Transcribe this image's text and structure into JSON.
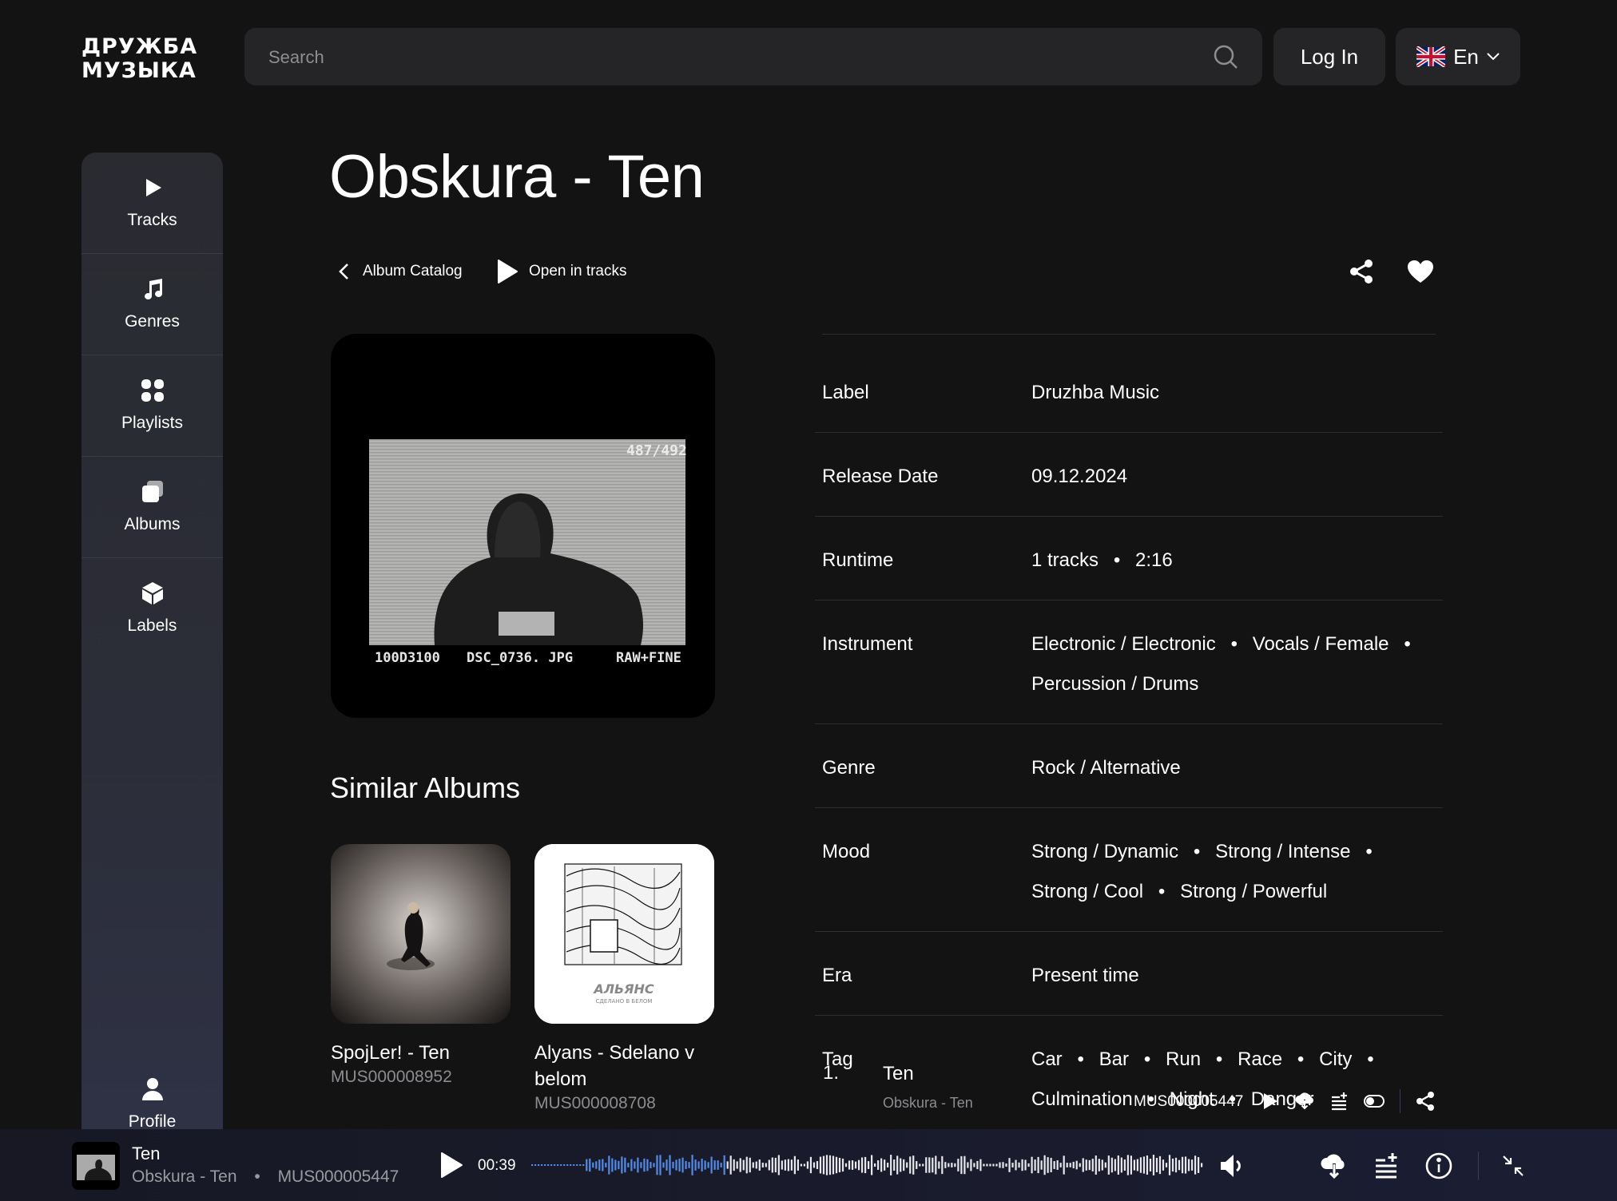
{
  "header": {
    "logo_line1": "ДРУЖБА",
    "logo_line2": "МУЗЫКА",
    "search_placeholder": "Search",
    "login_label": "Log In",
    "language": "En"
  },
  "sidebar": {
    "items": [
      {
        "label": "Tracks",
        "icon": "play-icon"
      },
      {
        "label": "Genres",
        "icon": "music-note-icon"
      },
      {
        "label": "Playlists",
        "icon": "grid-icon"
      },
      {
        "label": "Albums",
        "icon": "albums-icon"
      },
      {
        "label": "Labels",
        "icon": "cube-icon"
      }
    ],
    "profile_label": "Profile"
  },
  "album": {
    "title": "Obskura - Ten",
    "back_label": "Album Catalog",
    "open_tracks_label": "Open in tracks",
    "cover_counter": "487/492",
    "cover_footer_left": "100D3100",
    "cover_footer_mid": "DSC_0736. JPG",
    "cover_footer_right": "RAW+FINE"
  },
  "info": {
    "label": {
      "key": "Label",
      "value": "Druzhba Music"
    },
    "release": {
      "key": "Release Date",
      "value": "09.12.2024"
    },
    "runtime": {
      "key": "Runtime",
      "tracks": "1 tracks",
      "duration": "2:16"
    },
    "instrument": {
      "key": "Instrument",
      "values": [
        "Electronic / Electronic",
        "Vocals / Female",
        "Percussion / Drums"
      ]
    },
    "genre": {
      "key": "Genre",
      "value": "Rock / Alternative"
    },
    "mood": {
      "key": "Mood",
      "values": [
        "Strong / Dynamic",
        "Strong / Intense",
        "Strong / Cool",
        "Strong / Powerful"
      ]
    },
    "era": {
      "key": "Era",
      "value": "Present time"
    },
    "tag": {
      "key": "Tag",
      "values": [
        "Car",
        "Bar",
        "Run",
        "Race",
        "City",
        "Culmination",
        "Night",
        "Danger"
      ]
    }
  },
  "similar": {
    "heading": "Similar Albums",
    "items": [
      {
        "name": "SpojLer! - Ten",
        "code": "MUS000008952"
      },
      {
        "name": "Alyans - Sdelano v belom",
        "code": "MUS000008708",
        "cover_text": "АЛЬЯНС",
        "cover_subtext": "СДЕЛАНО В БЕЛОМ"
      }
    ]
  },
  "tracks": [
    {
      "num": "1.",
      "title": "Ten",
      "subtitle": "Obskura - Ten",
      "code": "MUS000005447"
    }
  ],
  "player": {
    "title": "Ten",
    "subtitle": "Obskura - Ten",
    "code": "MUS000005447",
    "time": "00:39",
    "progress": 0.29,
    "accent": "#4f8cf0"
  }
}
